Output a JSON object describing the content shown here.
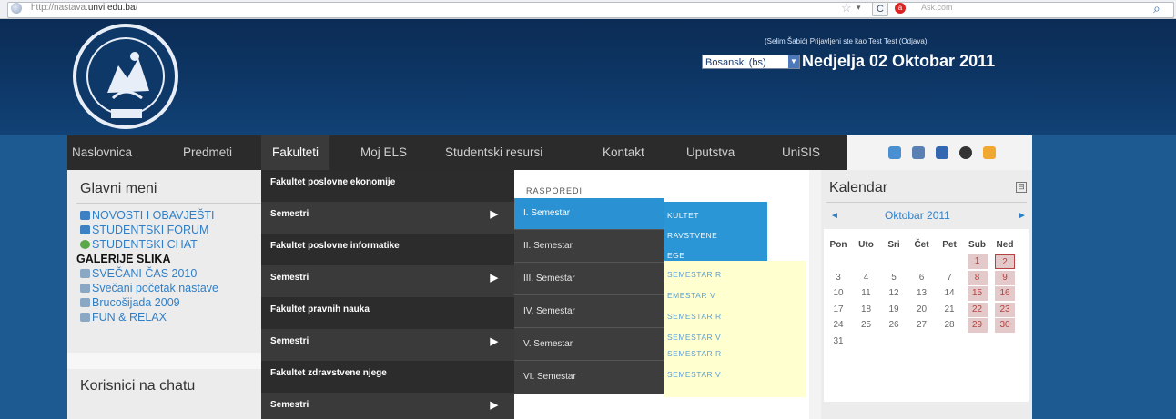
{
  "browser": {
    "url_prefix": "http://nastava.",
    "url_domain": "unvi.edu.ba",
    "url_suffix": "/",
    "search_placeholder": "Ask.com",
    "reload_label": "C",
    "search_logo": "a"
  },
  "header": {
    "login_info": "(Selim Šabić) Prijavljeni ste kao Test Test (Odjava)",
    "language": "Bosanski (bs)",
    "date": "Nedjelja 02 Oktobar 2011"
  },
  "nav": {
    "items": [
      "Naslovnica",
      "Predmeti",
      "Fakulteti",
      "Moj ELS",
      "Studentski resursi",
      "Kontakt",
      "Uputstva",
      "UniSIS"
    ]
  },
  "main_menu": {
    "title": "Glavni meni",
    "items": [
      "NOVOSTI I OBAVJEŠTI",
      "STUDENTSKI FORUM",
      "STUDENTSKI CHAT",
      "GALERIJE SLIKA",
      "SVEČANI ČAS 2010",
      "Svečani početak nastave",
      "Brucošijada 2009",
      "FUN & RELAX"
    ]
  },
  "chat_users": {
    "title": "Korisnici na chatu"
  },
  "dropdown": {
    "items": [
      {
        "label": "Fakultet poslovne ekonomije",
        "has_sub": false
      },
      {
        "label": "Semestri",
        "has_sub": true
      },
      {
        "label": "Fakultet poslovne informatike",
        "has_sub": false
      },
      {
        "label": "Semestri",
        "has_sub": true
      },
      {
        "label": "Fakultet pravnih nauka",
        "has_sub": false
      },
      {
        "label": "Semestri",
        "has_sub": true
      },
      {
        "label": "Fakultet zdravstvene njege",
        "has_sub": false
      },
      {
        "label": "Semestri",
        "has_sub": true
      }
    ]
  },
  "submenu": {
    "items": [
      "I. Semestar",
      "II. Semestar",
      "III. Semestar",
      "IV. Semestar",
      "V. Semestar",
      "VI. Semestar"
    ],
    "active_index": 0
  },
  "center": {
    "rasporedi": "RASPOREDI",
    "blue_lines": [
      "KULTET",
      "RAVSTVENE",
      "EGE"
    ],
    "yellow_lines": [
      "SEMESTAR R",
      "EMESTAR V",
      "SEMESTAR R",
      "SEMESTAR V",
      "SEMESTAR R",
      "SEMESTAR V"
    ]
  },
  "calendar": {
    "title": "Kalendar",
    "collapse_icon": "⊟",
    "prev": "◄",
    "next": "►",
    "month": "Oktobar 2011",
    "weekdays": [
      "Pon",
      "Uto",
      "Sri",
      "Čet",
      "Pet",
      "Sub",
      "Ned"
    ],
    "days": [
      [
        "",
        "",
        "",
        "",
        "",
        "1",
        "2"
      ],
      [
        "3",
        "4",
        "5",
        "6",
        "7",
        "8",
        "9"
      ],
      [
        "10",
        "11",
        "12",
        "13",
        "14",
        "15",
        "16"
      ],
      [
        "17",
        "18",
        "19",
        "20",
        "21",
        "22",
        "23"
      ],
      [
        "24",
        "25",
        "26",
        "27",
        "28",
        "29",
        "30"
      ],
      [
        "31",
        "",
        "",
        "",
        "",
        "",
        ""
      ]
    ],
    "today": "2"
  },
  "colors": {
    "header_bg": "#0e3868",
    "navbar_bg": "#2b2b2b",
    "link_blue": "#2f7fc8",
    "active_blue": "#2a92d2",
    "weekend": "#e3c9c9"
  }
}
